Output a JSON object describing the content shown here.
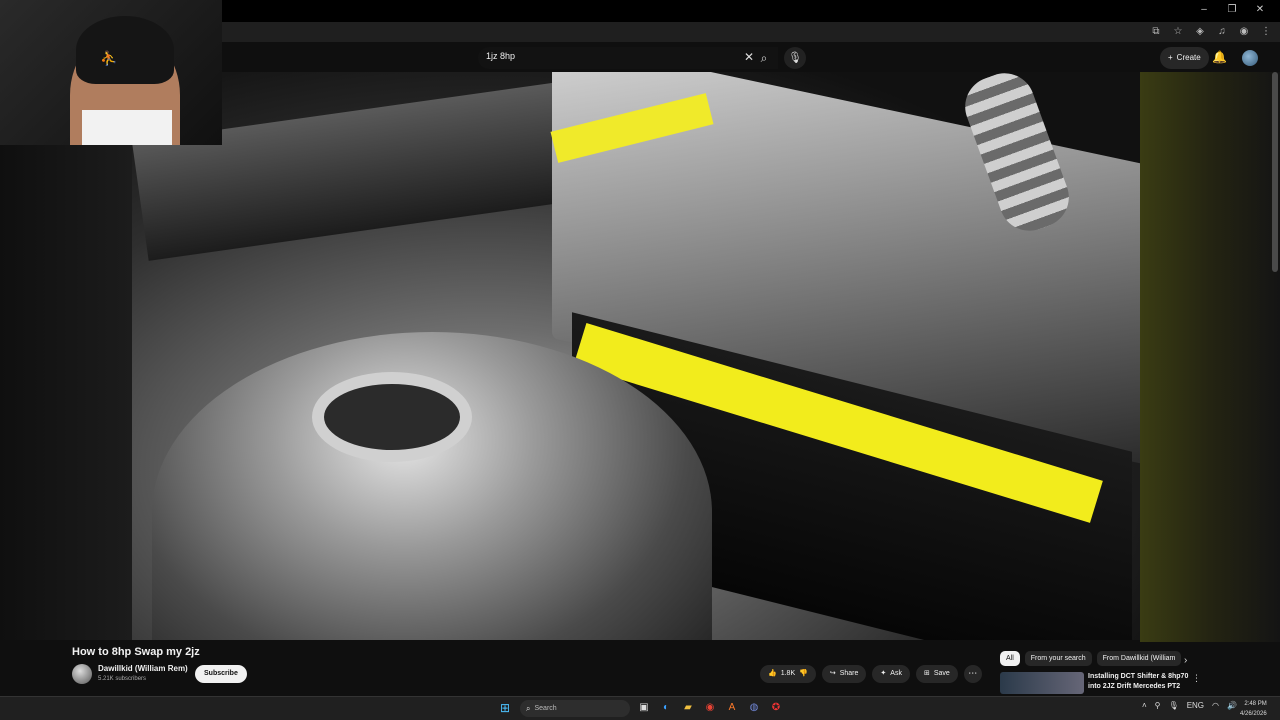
{
  "search": {
    "query": "1jz 8hp",
    "clear_icon": "close-icon",
    "search_icon": "search-icon",
    "mic_icon": "mic-icon"
  },
  "header": {
    "create_label": "Create",
    "bell_icon": "bell-icon"
  },
  "video": {
    "title": "How to 8hp Swap my 2jz",
    "channel": "Dawillkid (William Rem)",
    "subscribers": "5.21K subscribers",
    "subscribe_label": "Subscribe"
  },
  "actions": {
    "likes": "1.8K",
    "share_label": "Share",
    "ask_label": "Ask",
    "save_label": "Save"
  },
  "chips": [
    "All",
    "From your search",
    "From Dawillkid (William"
  ],
  "recommendation": {
    "title_line1": "Installing DCT Shifter & 8hp70",
    "title_line2": "into 2JZ Drift Mercedes PT2"
  },
  "taskbar": {
    "search_placeholder": "Search",
    "lang": "ENG",
    "time": "2:48 PM",
    "date": "4/26/2026"
  },
  "colors": {
    "accent_blue": "#4cc2ff",
    "tape_yellow": "#f2ec1c",
    "bg": "#0f0f0f"
  }
}
